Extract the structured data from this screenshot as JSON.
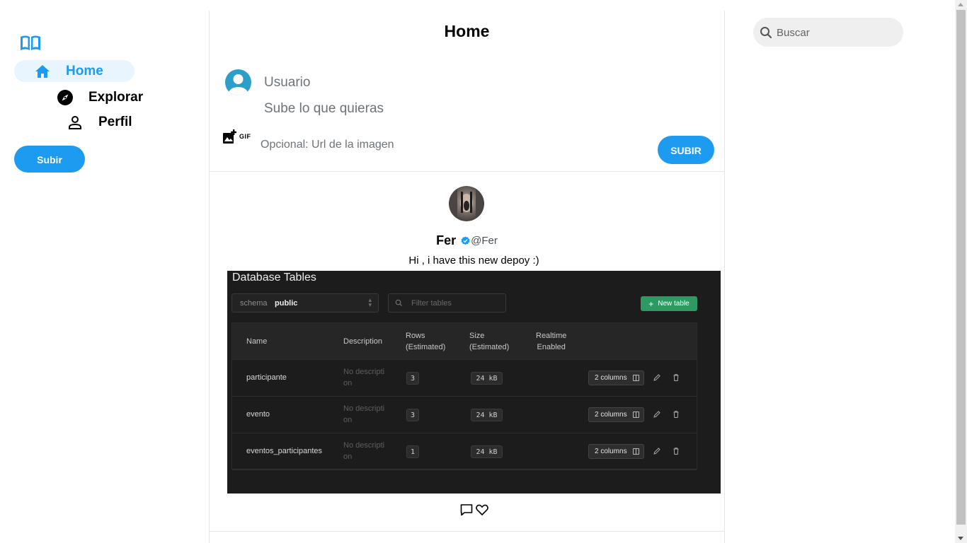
{
  "sidebar": {
    "logo_icon": "book-open-icon",
    "items": [
      {
        "label": "Home",
        "icon": "home-icon",
        "active": true
      },
      {
        "label": "Explorar",
        "icon": "compass-icon",
        "active": false
      },
      {
        "label": "Perfil",
        "icon": "person-icon",
        "active": false
      }
    ],
    "post_button": "Subir"
  },
  "main": {
    "title": "Home",
    "composer": {
      "username": "Usuario",
      "text_placeholder": "Sube lo que quieras",
      "url_placeholder": "Opcional: Url de la imagen",
      "gif_label": "GIF",
      "submit_label": "SUBIR"
    },
    "posts": [
      {
        "author": "Fer",
        "handle": "@Fer",
        "verified": true,
        "text": "Hi , i have this new depoy :)",
        "image": {
          "title": "Database Tables",
          "schema_label": "schema",
          "schema_value": "public",
          "filter_placeholder": "Filter tables",
          "new_table_label": "New table",
          "headers": [
            "Name",
            "Description",
            "Rows\n(Estimated)",
            "Size\n(Estimated)",
            "Realtime\nEnabled"
          ],
          "header_1": "Name",
          "header_2": "Description",
          "header_3a": "Rows",
          "header_3b": "(Estimated)",
          "header_4a": "Size",
          "header_4b": "(Estimated)",
          "header_5a": "Realtime",
          "header_5b": "Enabled",
          "rows": [
            {
              "name": "participante",
              "desc_a": "No descripti",
              "desc_b": "on",
              "rows": "3",
              "size": "24 kB",
              "columns": "2 columns"
            },
            {
              "name": "evento",
              "desc_a": "No descripti",
              "desc_b": "on",
              "rows": "3",
              "size": "24 kB",
              "columns": "2 columns"
            },
            {
              "name": "eventos_participantes",
              "desc_a": "No descripti",
              "desc_b": "on",
              "rows": "1",
              "size": "24 kB",
              "columns": "2 columns"
            }
          ]
        }
      }
    ]
  },
  "search": {
    "placeholder": "Buscar"
  },
  "colors": {
    "accent": "#1d9bf0",
    "active_bg": "#e8f5fe",
    "divider": "#e6e6e6"
  }
}
